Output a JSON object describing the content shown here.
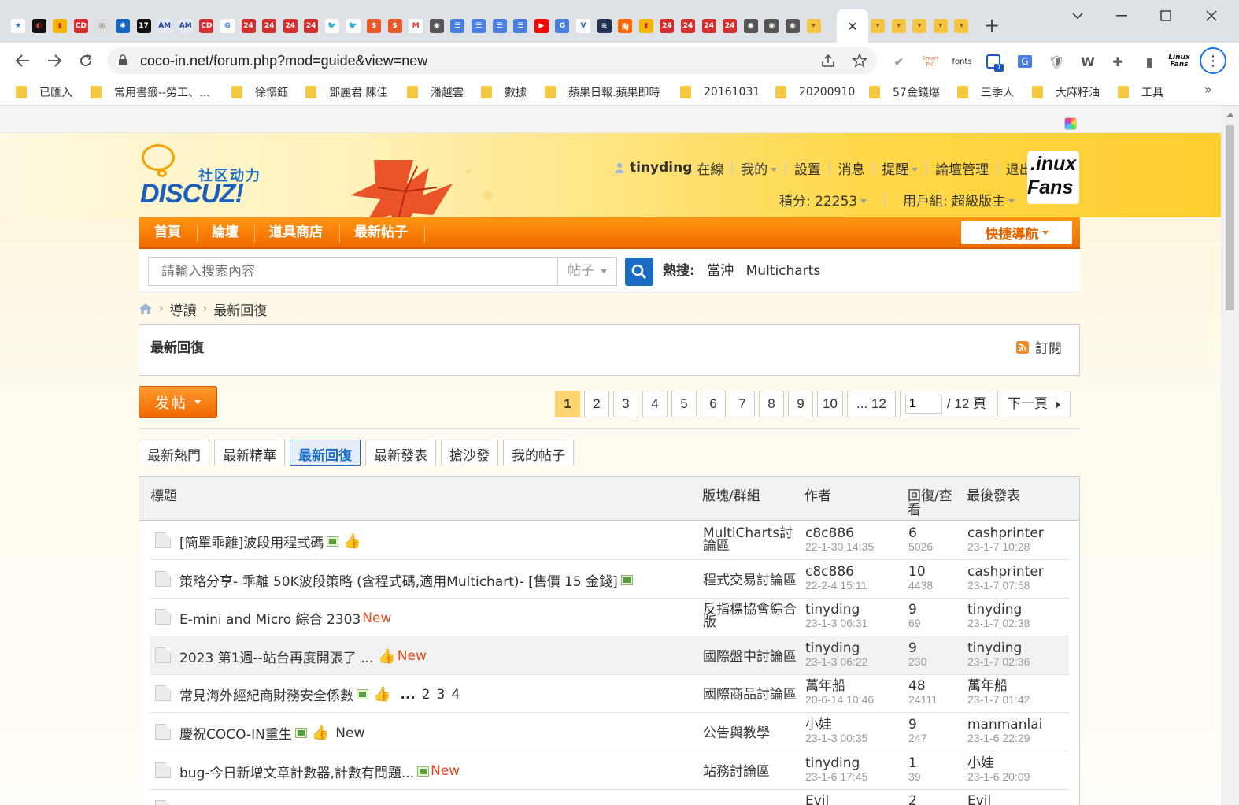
{
  "browser": {
    "url": "coco-in.net/forum.php?mod=guide&view=new",
    "new_tab": "+",
    "close_tab": "✕",
    "tab_icons": [
      {
        "bg": "#ffffff",
        "fg": "#1a73e8",
        "t": "★"
      },
      {
        "bg": "#111111",
        "fg": "#e53935",
        "t": "◐"
      },
      {
        "bg": "#f4b400",
        "fg": "#d32f2f",
        "t": "▮"
      },
      {
        "bg": "#d32f2f",
        "fg": "#ffffff",
        "t": "CD"
      },
      {
        "bg": "#dddddd",
        "fg": "#666666",
        "t": "◎"
      },
      {
        "bg": "#1565c0",
        "fg": "#ffffff",
        "t": "✱"
      },
      {
        "bg": "#111111",
        "fg": "#ffffff",
        "t": "17"
      },
      {
        "bg": "#e3eaf5",
        "fg": "#1a3f8a",
        "t": "AM"
      },
      {
        "bg": "#e3eaf5",
        "fg": "#1a3f8a",
        "t": "AM"
      },
      {
        "bg": "#d32f2f",
        "fg": "#ffffff",
        "t": "CD"
      },
      {
        "bg": "#ffffff",
        "fg": "#4285f4",
        "t": "G"
      },
      {
        "bg": "#d32f2f",
        "fg": "#ffffff",
        "t": "24"
      },
      {
        "bg": "#d32f2f",
        "fg": "#ffffff",
        "t": "24"
      },
      {
        "bg": "#d32f2f",
        "fg": "#ffffff",
        "t": "24"
      },
      {
        "bg": "#d32f2f",
        "fg": "#ffffff",
        "t": "24"
      },
      {
        "bg": "#ffffff",
        "fg": "#1da1f2",
        "t": "🐦"
      },
      {
        "bg": "#ffffff",
        "fg": "#1da1f2",
        "t": "🐦"
      },
      {
        "bg": "#e65a2a",
        "fg": "#ffffff",
        "t": "$"
      },
      {
        "bg": "#e65a2a",
        "fg": "#ffffff",
        "t": "$"
      },
      {
        "bg": "#ffffff",
        "fg": "#d93025",
        "t": "M"
      },
      {
        "bg": "#555555",
        "fg": "#ffffff",
        "t": "◉"
      },
      {
        "bg": "#4a7fe0",
        "fg": "#ffffff",
        "t": "☰"
      },
      {
        "bg": "#4a7fe0",
        "fg": "#ffffff",
        "t": "☰"
      },
      {
        "bg": "#4a7fe0",
        "fg": "#ffffff",
        "t": "☰"
      },
      {
        "bg": "#4a7fe0",
        "fg": "#ffffff",
        "t": "☰"
      },
      {
        "bg": "#ff0000",
        "fg": "#ffffff",
        "t": "▶"
      },
      {
        "bg": "#4a7fe0",
        "fg": "#ffffff",
        "t": "G"
      },
      {
        "bg": "#ffffff",
        "fg": "#1565c0",
        "t": "V"
      },
      {
        "bg": "#223355",
        "fg": "#ffffff",
        "t": "≋"
      },
      {
        "bg": "#ff6a00",
        "fg": "#ffffff",
        "t": "淘"
      },
      {
        "bg": "#f4b400",
        "fg": "#d32f2f",
        "t": "▮"
      },
      {
        "bg": "#d32f2f",
        "fg": "#ffffff",
        "t": "24"
      },
      {
        "bg": "#d32f2f",
        "fg": "#ffffff",
        "t": "24"
      },
      {
        "bg": "#d32f2f",
        "fg": "#ffffff",
        "t": "24"
      },
      {
        "bg": "#d32f2f",
        "fg": "#ffffff",
        "t": "24"
      },
      {
        "bg": "#555555",
        "fg": "#ffffff",
        "t": "◉"
      },
      {
        "bg": "#555555",
        "fg": "#ffffff",
        "t": "◉"
      },
      {
        "bg": "#555555",
        "fg": "#ffffff",
        "t": "◉"
      },
      {
        "bg": "#f5c542",
        "fg": "#8a5a00",
        "t": "▾"
      }
    ],
    "tab_icons_right": [
      {
        "bg": "#f5c542",
        "fg": "#8a5a00",
        "t": "▾"
      },
      {
        "bg": "#f5c542",
        "fg": "#8a5a00",
        "t": "▾"
      },
      {
        "bg": "#f5c542",
        "fg": "#8a5a00",
        "t": "▾"
      },
      {
        "bg": "#f5c542",
        "fg": "#8a5a00",
        "t": "▾"
      },
      {
        "bg": "#f5c542",
        "fg": "#8a5a00",
        "t": "▾"
      }
    ],
    "extensions": [
      "✔",
      "Smart PKI",
      "fonts",
      "1",
      "G",
      "🛡",
      "W",
      "✚",
      "▮",
      "Linux Fans",
      "⋮"
    ],
    "bookmarks": [
      "已匯入",
      "常用書籤--勞工、...",
      "徐懷鈺",
      "鄧麗君 陳佳",
      "潘越雲",
      "數據",
      "蘋果日報.蘋果即時",
      "20161031",
      "20200910",
      "57金錢爆",
      "三季人",
      "大麻籽油",
      "工具"
    ],
    "bookmarks_more": "»"
  },
  "header": {
    "logo_sub": "社区动力",
    "logo_main": "DISCUZ!",
    "username": "tinyding",
    "online": "在線",
    "my": "我的",
    "settings": "設置",
    "messages": "消息",
    "reminders": "提醒",
    "forum_admin": "論壇管理",
    "logout": "退出",
    "credits": "積分: 22253",
    "usergroup": "用戶組: 超級版主",
    "badge_line1": ".inux",
    "badge_line2": "Fans"
  },
  "nav": {
    "items": [
      "首頁",
      "論壇",
      "道具商店",
      "最新帖子"
    ],
    "quick": "快捷導航"
  },
  "search": {
    "placeholder": "請輸入搜索內容",
    "type": "帖子",
    "hot_label": "熱搜:",
    "hot_terms": [
      "當沖",
      "Multicharts"
    ]
  },
  "breadcrumb": {
    "guide": "導讀",
    "current": "最新回復"
  },
  "titlebox": {
    "title": "最新回復",
    "subscribe": "訂閱"
  },
  "post_button": "发帖",
  "pager": {
    "pages": [
      "1",
      "2",
      "3",
      "4",
      "5",
      "6",
      "7",
      "8",
      "9",
      "10",
      "... 12"
    ],
    "current": "1",
    "input_value": "1",
    "total": "/ 12 頁",
    "next": "下一頁"
  },
  "tabs": [
    "最新熱門",
    "最新精華",
    "最新回復",
    "最新發表",
    "搶沙發",
    "我的帖子"
  ],
  "active_tab": "最新回復",
  "table": {
    "headers": {
      "title": "標題",
      "forum": "版塊/群組",
      "author": "作者",
      "replies": "回復/查看",
      "last": "最後發表"
    },
    "rows": [
      {
        "title": "[簡單乖離]波段用程式碼",
        "img": true,
        "thumb": true,
        "new": "",
        "pages": [],
        "forum": "MultiCharts討論區",
        "author": "c8c886",
        "date": "22-1-30 14:35",
        "replies": "6",
        "views": "5026",
        "last_user": "cashprinter",
        "last_date": "23-1-7 10:28"
      },
      {
        "title": "策略分享- 乖離 50K波段策略 (含程式碼,適用Multichart)- [售價 15 金錢]",
        "img": true,
        "thumb": false,
        "new": "",
        "pages": [],
        "forum": "程式交易討論區",
        "author": "c8c886",
        "date": "22-2-4 15:11",
        "replies": "10",
        "views": "4438",
        "last_user": "cashprinter",
        "last_date": "23-1-7 07:58"
      },
      {
        "title": "E-mini and Micro 綜合 2303",
        "img": false,
        "thumb": false,
        "new": "New",
        "pages": [],
        "forum": "反指標協會綜合版",
        "author": "tinyding",
        "date": "23-1-3 06:31",
        "replies": "9",
        "views": "69",
        "last_user": "tinyding",
        "last_date": "23-1-7 02:38"
      },
      {
        "title": "2023 第1週--站台再度開張了 ...",
        "img": false,
        "thumb": true,
        "new": "New",
        "pages": [],
        "forum": "國際盤中討論區",
        "author": "tinyding",
        "date": "23-1-3 06:22",
        "replies": "9",
        "views": "230",
        "last_user": "tinyding",
        "last_date": "23-1-7 02:36"
      },
      {
        "title": "常見海外經紀商財務安全係數",
        "img": true,
        "thumb": true,
        "new": "",
        "pages_prefix": "...",
        "pages": [
          "2",
          "3",
          "4"
        ],
        "forum": "國際商品討論區",
        "author": "萬年船",
        "date": "20-6-14 10:46",
        "replies": "48",
        "views": "24111",
        "last_user": "萬年船",
        "last_date": "23-1-7 01:42"
      },
      {
        "title": "慶祝COCO-IN重生",
        "img": true,
        "thumb": true,
        "new": "New",
        "new_plain": true,
        "pages": [],
        "forum": "公告與教學",
        "author": "小娃",
        "date": "23-1-3 00:35",
        "replies": "9",
        "views": "247",
        "last_user": "manmanlai",
        "last_date": "23-1-6 22:29"
      },
      {
        "title": "bug-今日新增文章計數器,計數有問題...",
        "img": true,
        "thumb": false,
        "new": "New",
        "pages": [],
        "forum": "站務討論區",
        "author": "tinyding",
        "date": "23-1-6 17:45",
        "replies": "1",
        "views": "39",
        "last_user": "小娃",
        "last_date": "23-1-6 20:09"
      },
      {
        "title": "",
        "img": false,
        "thumb": false,
        "new": "",
        "pages": [],
        "forum": "",
        "author": "Evil",
        "date": "",
        "replies": "2",
        "views": "",
        "last_user": "Evil",
        "last_date": ""
      }
    ]
  },
  "colors": {
    "orange": "#f07a0a",
    "blue": "#1d6ec5",
    "new_red": "#e04a1f",
    "pager_current": "#ffd36e"
  }
}
